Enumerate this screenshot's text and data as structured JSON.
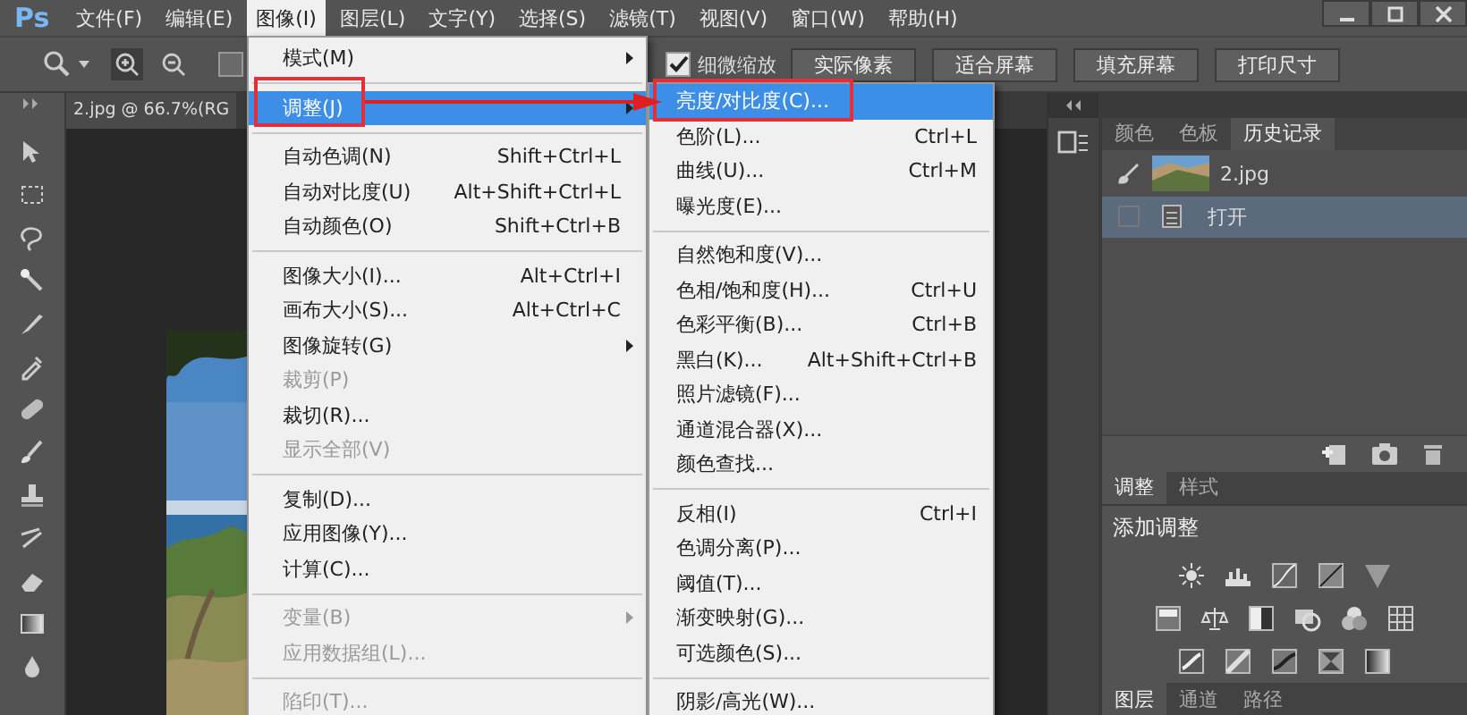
{
  "app_logo": "Ps",
  "menubar": [
    {
      "label": "文件(F)",
      "selected": false
    },
    {
      "label": "编辑(E)",
      "selected": false
    },
    {
      "label": "图像(I)",
      "selected": true
    },
    {
      "label": "图层(L)",
      "selected": false
    },
    {
      "label": "文字(Y)",
      "selected": false
    },
    {
      "label": "选择(S)",
      "selected": false
    },
    {
      "label": "滤镜(T)",
      "selected": false
    },
    {
      "label": "视图(V)",
      "selected": false
    },
    {
      "label": "窗口(W)",
      "selected": false
    },
    {
      "label": "帮助(H)",
      "selected": false
    }
  ],
  "options_bar": {
    "resize_windows": {
      "checked": false
    },
    "fine_zoom": {
      "label": "细微缩放",
      "checked": true
    },
    "buttons": [
      "实际像素",
      "适合屏幕",
      "填充屏幕",
      "打印尺寸"
    ]
  },
  "document_tab": "2.jpg @ 66.7%(RG",
  "image_menu": [
    {
      "kind": "item",
      "label": "模式(M)",
      "disabled": false,
      "has_submenu": true,
      "selected": false
    },
    {
      "kind": "separator"
    },
    {
      "kind": "item",
      "label": "调整(J)",
      "disabled": false,
      "has_submenu": true,
      "selected": true
    },
    {
      "kind": "separator"
    },
    {
      "kind": "item",
      "label": "自动色调(N)",
      "shortcut": "Shift+Ctrl+L",
      "disabled": false,
      "has_submenu": false,
      "selected": false
    },
    {
      "kind": "item",
      "label": "自动对比度(U)",
      "shortcut": "Alt+Shift+Ctrl+L",
      "disabled": false,
      "has_submenu": false,
      "selected": false
    },
    {
      "kind": "item",
      "label": "自动颜色(O)",
      "shortcut": "Shift+Ctrl+B",
      "disabled": false,
      "has_submenu": false,
      "selected": false
    },
    {
      "kind": "separator"
    },
    {
      "kind": "item",
      "label": "图像大小(I)...",
      "shortcut": "Alt+Ctrl+I",
      "disabled": false,
      "has_submenu": false,
      "selected": false
    },
    {
      "kind": "item",
      "label": "画布大小(S)...",
      "shortcut": "Alt+Ctrl+C",
      "disabled": false,
      "has_submenu": false,
      "selected": false
    },
    {
      "kind": "item",
      "label": "图像旋转(G)",
      "disabled": false,
      "has_submenu": true,
      "selected": false
    },
    {
      "kind": "item",
      "label": "裁剪(P)",
      "disabled": true,
      "has_submenu": false,
      "selected": false
    },
    {
      "kind": "item",
      "label": "裁切(R)...",
      "disabled": false,
      "has_submenu": false,
      "selected": false
    },
    {
      "kind": "item",
      "label": "显示全部(V)",
      "disabled": true,
      "has_submenu": false,
      "selected": false
    },
    {
      "kind": "separator"
    },
    {
      "kind": "item",
      "label": "复制(D)...",
      "disabled": false,
      "has_submenu": false,
      "selected": false
    },
    {
      "kind": "item",
      "label": "应用图像(Y)...",
      "disabled": false,
      "has_submenu": false,
      "selected": false
    },
    {
      "kind": "item",
      "label": "计算(C)...",
      "disabled": false,
      "has_submenu": false,
      "selected": false
    },
    {
      "kind": "separator"
    },
    {
      "kind": "item",
      "label": "变量(B)",
      "disabled": true,
      "has_submenu": true,
      "selected": false
    },
    {
      "kind": "item",
      "label": "应用数据组(L)...",
      "disabled": true,
      "has_submenu": false,
      "selected": false
    },
    {
      "kind": "separator"
    },
    {
      "kind": "item",
      "label": "陷印(T)...",
      "disabled": true,
      "has_submenu": false,
      "selected": false
    }
  ],
  "adjust_submenu": [
    {
      "kind": "item",
      "label": "亮度/对比度(C)...",
      "selected": true
    },
    {
      "kind": "item",
      "label": "色阶(L)...",
      "shortcut": "Ctrl+L",
      "selected": false
    },
    {
      "kind": "item",
      "label": "曲线(U)...",
      "shortcut": "Ctrl+M",
      "selected": false
    },
    {
      "kind": "item",
      "label": "曝光度(E)...",
      "selected": false
    },
    {
      "kind": "separator"
    },
    {
      "kind": "item",
      "label": "自然饱和度(V)...",
      "selected": false
    },
    {
      "kind": "item",
      "label": "色相/饱和度(H)...",
      "shortcut": "Ctrl+U",
      "selected": false
    },
    {
      "kind": "item",
      "label": "色彩平衡(B)...",
      "shortcut": "Ctrl+B",
      "selected": false
    },
    {
      "kind": "item",
      "label": "黑白(K)...",
      "shortcut": "Alt+Shift+Ctrl+B",
      "selected": false
    },
    {
      "kind": "item",
      "label": "照片滤镜(F)...",
      "selected": false
    },
    {
      "kind": "item",
      "label": "通道混合器(X)...",
      "selected": false
    },
    {
      "kind": "item",
      "label": "颜色查找...",
      "selected": false
    },
    {
      "kind": "separator"
    },
    {
      "kind": "item",
      "label": "反相(I)",
      "shortcut": "Ctrl+I",
      "selected": false
    },
    {
      "kind": "item",
      "label": "色调分离(P)...",
      "selected": false
    },
    {
      "kind": "item",
      "label": "阈值(T)...",
      "selected": false
    },
    {
      "kind": "item",
      "label": "渐变映射(G)...",
      "selected": false
    },
    {
      "kind": "item",
      "label": "可选颜色(S)...",
      "selected": false
    },
    {
      "kind": "separator"
    },
    {
      "kind": "item",
      "label": "阴影/高光(W)...",
      "selected": false
    }
  ],
  "history_panel": {
    "tabs": [
      {
        "label": "颜色",
        "selected": false
      },
      {
        "label": "色板",
        "selected": false
      },
      {
        "label": "历史记录",
        "selected": true
      }
    ],
    "items": [
      {
        "kind": "snapshot",
        "label": "2.jpg",
        "selected": false
      },
      {
        "kind": "step",
        "label": "打开",
        "selected": true
      }
    ]
  },
  "adjustments_panel": {
    "tabs": [
      {
        "label": "调整",
        "selected": true
      },
      {
        "label": "样式",
        "selected": false
      }
    ],
    "title": "添加调整"
  },
  "layers_panel": {
    "tabs": [
      {
        "label": "图层",
        "selected": true
      },
      {
        "label": "通道",
        "selected": false
      },
      {
        "label": "路径",
        "selected": false
      }
    ]
  }
}
